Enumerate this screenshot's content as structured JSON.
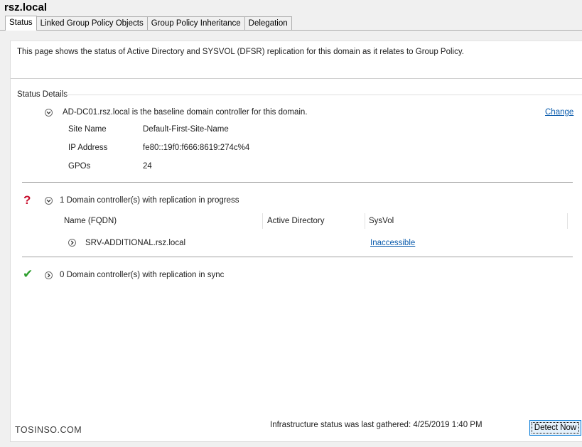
{
  "header": {
    "title": "rsz.local"
  },
  "tabs": [
    {
      "label": "Status",
      "active": true
    },
    {
      "label": "Linked Group Policy Objects",
      "active": false
    },
    {
      "label": "Group Policy Inheritance",
      "active": false
    },
    {
      "label": "Delegation",
      "active": false
    }
  ],
  "description": "This page shows the status of Active Directory and SYSVOL (DFSR) replication for this domain as it relates to Group Policy.",
  "status_details": {
    "label": "Status Details",
    "baseline": {
      "text": "AD-DC01.rsz.local is the baseline domain controller for this domain.",
      "change_link": "Change",
      "fields": [
        {
          "label": "Site Name",
          "value": "Default-First-Site-Name"
        },
        {
          "label": "IP Address",
          "value": "fe80::19f0:f666:8619:274c%4"
        },
        {
          "label": "GPOs",
          "value": "24"
        }
      ]
    },
    "in_progress": {
      "text": "1 Domain controller(s) with replication in progress",
      "columns": [
        "Name (FQDN)",
        "Active Directory",
        "SysVol"
      ],
      "rows": [
        {
          "name": "SRV-ADDITIONAL.rsz.local",
          "active_directory": "",
          "sysvol": "Inaccessible"
        }
      ]
    },
    "in_sync": {
      "text": "0 Domain controller(s) with replication in sync"
    }
  },
  "footer": {
    "status": "Infrastructure status was last gathered: 4/25/2019 1:40 PM",
    "detect_button": "Detect Now"
  },
  "watermark": "TOSINSO.COM",
  "colors": {
    "link": "#0b5cad",
    "warning": "#c8102e",
    "success": "#2e9e2e",
    "button_border": "#0078d7"
  }
}
